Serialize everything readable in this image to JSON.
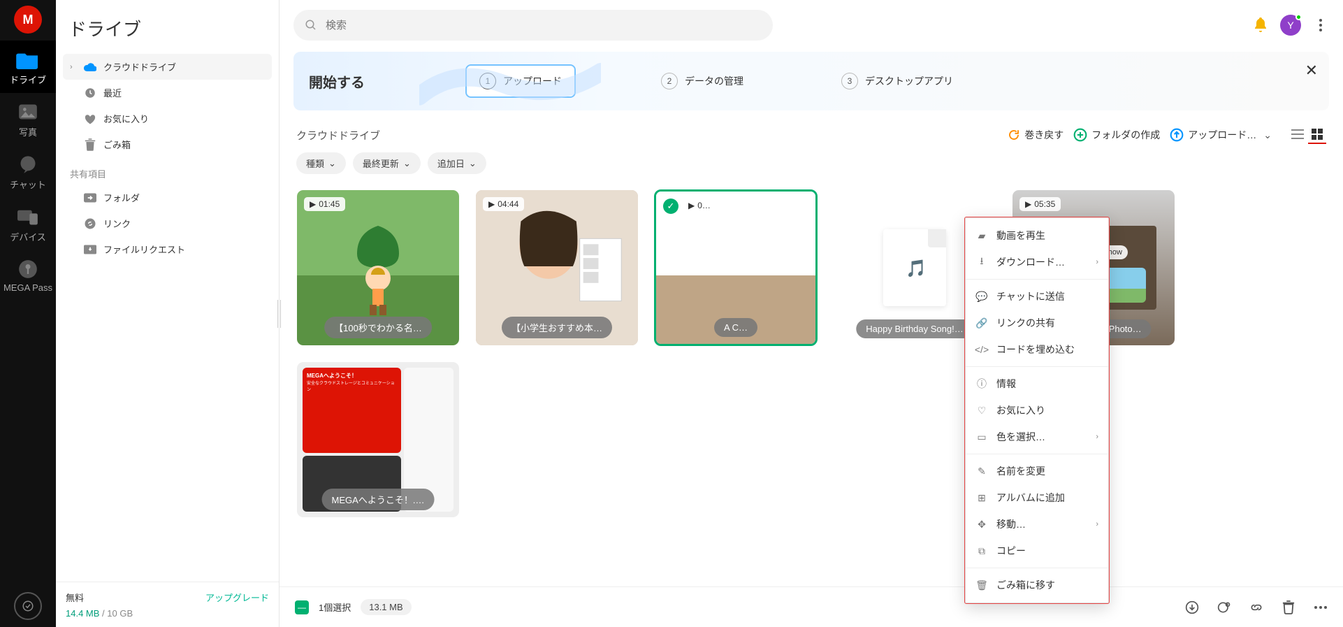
{
  "rail": {
    "logo_letter": "M",
    "items": [
      {
        "label": "ドライブ",
        "active": true
      },
      {
        "label": "写真",
        "active": false
      },
      {
        "label": "チャット",
        "active": false
      },
      {
        "label": "デバイス",
        "active": false
      },
      {
        "label": "MEGA Pass",
        "active": false
      }
    ]
  },
  "sidebar": {
    "title": "ドライブ",
    "tree": [
      {
        "label": "クラウドドライブ",
        "icon": "cloud",
        "active": true,
        "expandable": true
      },
      {
        "label": "最近",
        "icon": "clock"
      },
      {
        "label": "お気に入り",
        "icon": "heart"
      },
      {
        "label": "ごみ箱",
        "icon": "trash"
      }
    ],
    "shared_label": "共有項目",
    "shared": [
      {
        "label": "フォルダ",
        "icon": "folder-share"
      },
      {
        "label": "リンク",
        "icon": "link"
      },
      {
        "label": "ファイルリクエスト",
        "icon": "inbox"
      }
    ],
    "footer": {
      "plan": "無料",
      "upgrade": "アップグレード",
      "used": "14.4 MB",
      "sep": " / ",
      "total": "10 GB"
    }
  },
  "search": {
    "placeholder": "検索"
  },
  "avatar_initial": "Y",
  "banner": {
    "title": "開始する",
    "steps": [
      {
        "num": "1",
        "label": "アップロード",
        "active": true
      },
      {
        "num": "2",
        "label": "データの管理",
        "active": false
      },
      {
        "num": "3",
        "label": "デスクトップアプリ",
        "active": false
      }
    ]
  },
  "breadcrumb": "クラウドドライブ",
  "toolbar": {
    "rewind": "巻き戻す",
    "new_folder": "フォルダの作成",
    "upload": "アップロード…"
  },
  "chips": [
    "種類",
    "最終更新",
    "追加日"
  ],
  "files": [
    {
      "duration": "01:45",
      "caption": "【100秒でわかる名…",
      "selected": false
    },
    {
      "duration": "04:44",
      "caption": "【小学生おすすめ本…",
      "selected": false
    },
    {
      "duration": "0…",
      "caption": "A C…",
      "selected": true
    },
    {
      "duration": "",
      "caption": "Happy Birthday Song!…",
      "selected": false
    },
    {
      "duration": "05:35",
      "caption": "How to Make a Photo…",
      "selected": false
    },
    {
      "duration": "",
      "caption": "MEGAへようこそ！.…",
      "selected": false
    }
  ],
  "context_menu": {
    "groups": [
      [
        {
          "label": "動画を再生",
          "icon": "video"
        },
        {
          "label": "ダウンロード…",
          "icon": "download",
          "submenu": true
        }
      ],
      [
        {
          "label": "チャットに送信",
          "icon": "chat"
        },
        {
          "label": "リンクの共有",
          "icon": "link"
        },
        {
          "label": "コードを埋め込む",
          "icon": "code"
        }
      ],
      [
        {
          "label": "情報",
          "icon": "info"
        },
        {
          "label": "お気に入り",
          "icon": "heart"
        },
        {
          "label": "色を選択…",
          "icon": "tag",
          "submenu": true
        }
      ],
      [
        {
          "label": "名前を変更",
          "icon": "pencil"
        },
        {
          "label": "アルバムに追加",
          "icon": "album"
        },
        {
          "label": "移動…",
          "icon": "move",
          "submenu": true
        },
        {
          "label": "コピー",
          "icon": "copy"
        }
      ],
      [
        {
          "label": "ごみ箱に移す",
          "icon": "trash"
        }
      ]
    ]
  },
  "statusbar": {
    "selection": "1個選択",
    "size": "13.1 MB"
  },
  "t6_text": "MEGAへようこそ！",
  "t6_sub": "安全なクラウドストレージとコミュニケーション",
  "photo_slideshow": "Photo Slideshow"
}
